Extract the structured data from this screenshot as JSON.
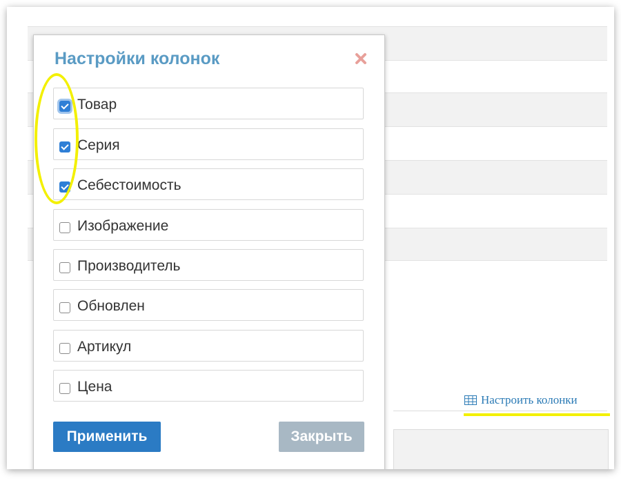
{
  "modal": {
    "title": "Настройки колонок",
    "columns": [
      {
        "label": "Товар",
        "checked": true
      },
      {
        "label": "Серия",
        "checked": true
      },
      {
        "label": "Себестоимость",
        "checked": true
      },
      {
        "label": "Изображение",
        "checked": false
      },
      {
        "label": "Производитель",
        "checked": false
      },
      {
        "label": "Обновлен",
        "checked": false
      },
      {
        "label": "Артикул",
        "checked": false
      },
      {
        "label": "Цена",
        "checked": false
      }
    ],
    "apply_label": "Применить",
    "close_label": "Закрыть"
  },
  "page": {
    "configure_columns_link": "Настроить колонки"
  },
  "icons": {
    "close": "close-icon",
    "table": "table-icon"
  },
  "colors": {
    "title": "#5a9bc4",
    "apply_button": "#2b7bc4",
    "close_button": "#a8b8c4",
    "checkbox_checked": "#2f7fd6",
    "link": "#2a7ab5",
    "highlight": "#f3f000",
    "close_icon": "#e8a09a"
  }
}
